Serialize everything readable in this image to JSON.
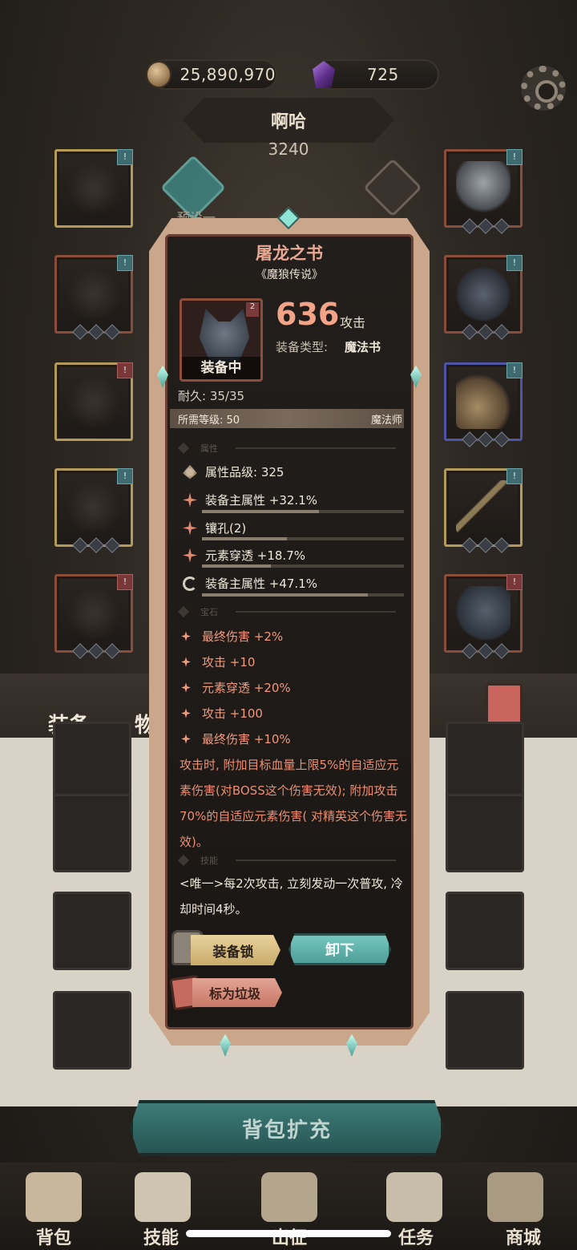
{
  "currency": {
    "coins": "25,890,970",
    "gems": "725"
  },
  "hero": {
    "name": "啊哈",
    "power": "3240",
    "preset_label": "预设一"
  },
  "item": {
    "name": "屠龙之书",
    "set": "《魔狼传说》",
    "equipped_label": "装备中",
    "attack_value": "636",
    "attack_unit": "攻击",
    "type_label": "装备类型:",
    "type_value": "魔法书",
    "durability": "耐久: 35/35",
    "required_level": "所需等级: 50",
    "required_class": "魔法师",
    "section_attributes": "属性",
    "attributes": [
      {
        "icon": "grade-icon",
        "text": "属性品级: 325",
        "bar": null
      },
      {
        "icon": "spark-icon",
        "text": "装备主属性 +32.1%",
        "bar": 0.58
      },
      {
        "icon": "spark-icon",
        "text": "镶孔(2)",
        "bar": 0.42
      },
      {
        "icon": "spark-icon",
        "text": "元素穿透 +18.7%",
        "bar": 0.34
      },
      {
        "icon": "cycle-icon",
        "text": "装备主属性 +47.1%",
        "bar": 0.82
      }
    ],
    "section_gems": "宝石",
    "gems": [
      "最终伤害 +2%",
      "攻击 +10",
      "元素穿透 +20%",
      "攻击 +100",
      "最终伤害 +10%"
    ],
    "gem_description": "攻击时, 附加目标血量上限5%的自适应元素伤害(对BOSS这个伤害无效); 附加攻击70%的自适应元素伤害( 对精英这个伤害无效)。",
    "section_skill": "技能",
    "skill_description": "<唯一>每2次攻击, 立刻发动一次普攻, 冷却时间4秒。",
    "buttons": {
      "lock": "装备锁",
      "unequip": "卸下",
      "junk": "标为垃圾"
    }
  },
  "tabs": {
    "equipment": "装备",
    "items": "物品"
  },
  "bag": {
    "expand": "背包扩充"
  },
  "nav": [
    "背包",
    "技能",
    "出征",
    "任务",
    "商城"
  ],
  "colors": {
    "accent_red": "#f3a488",
    "teal": "#4f9e97",
    "gold": "#c9ac6b"
  }
}
